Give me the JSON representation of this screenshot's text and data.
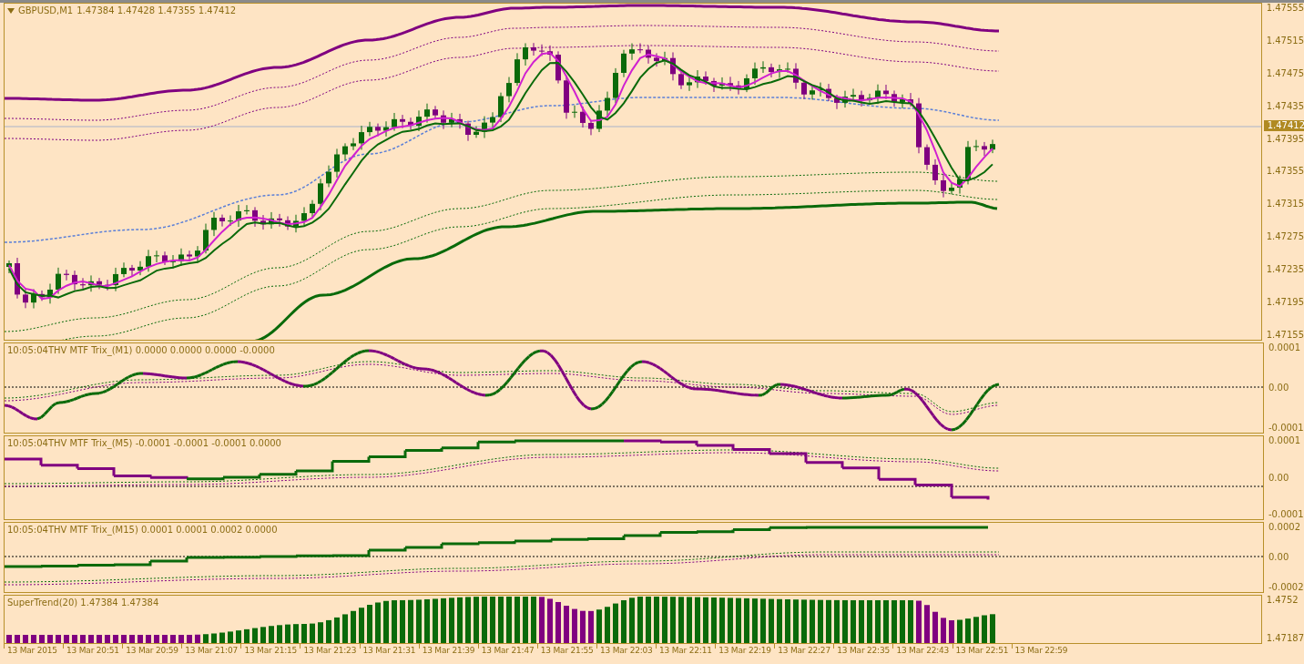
{
  "chart": {
    "symbol": "GBPUSD,M1",
    "ohlc": "1.47384 1.47428 1.47355 1.47412",
    "price_axis": [
      "1.47555",
      "1.47515",
      "1.47475",
      "1.47435",
      "1.47395",
      "1.47355",
      "1.47315",
      "1.47275",
      "1.47235",
      "1.47195",
      "1.47155"
    ],
    "current_price": "1.47412"
  },
  "indicators": [
    {
      "label": "10:05:04THV MTF Trix_(M1) 0.0000 0.0000 0.0000 -0.0000",
      "axis": [
        "0.0001",
        "0.00",
        "-0.0001"
      ]
    },
    {
      "label": "10:05:04THV MTF Trix_(M5) -0.0001 -0.0001 -0.0001 0.0000",
      "axis": [
        "0.0001",
        "0.00",
        "-0.0001"
      ]
    },
    {
      "label": "10:05:04THV MTF Trix_(M15) 0.0001 0.0001 0.0002 0.0000",
      "axis": [
        "0.0002",
        "0.00",
        "-0.0002"
      ]
    },
    {
      "label": "SuperTrend(20) 1.47384 1.47384",
      "axis": [
        "1.4752",
        "1.47187"
      ]
    }
  ],
  "time_axis": [
    "13 Mar 2015",
    "13 Mar 20:51",
    "13 Mar 20:59",
    "13 Mar 21:07",
    "13 Mar 21:15",
    "13 Mar 21:23",
    "13 Mar 21:31",
    "13 Mar 21:39",
    "13 Mar 21:47",
    "13 Mar 21:55",
    "13 Mar 22:03",
    "13 Mar 22:11",
    "13 Mar 22:19",
    "13 Mar 22:27",
    "13 Mar 22:35",
    "13 Mar 22:43",
    "13 Mar 22:51",
    "13 Mar 22:59"
  ]
}
